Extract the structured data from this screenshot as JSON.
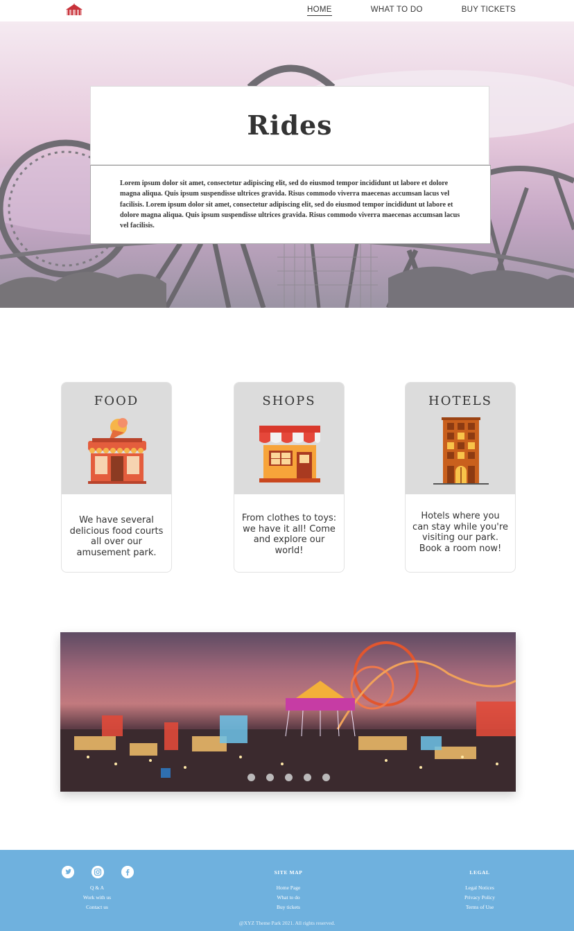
{
  "nav": {
    "links": [
      {
        "label": "HOME",
        "active": true
      },
      {
        "label": "WHAT TO DO",
        "active": false
      },
      {
        "label": "BUY TICKETS",
        "active": false
      }
    ]
  },
  "hero": {
    "title": "Rides",
    "text": "Lorem ipsum dolor sit amet, consectetur adipiscing elit, sed do eiusmod tempor incididunt ut labore et dolore magna aliqua. Quis ipsum suspendisse ultrices gravida. Risus commodo viverra maecenas accumsan lacus vel facilisis. Lorem ipsum dolor sit amet, consectetur adipiscing elit, sed do eiusmod tempor incididunt ut labore et dolore magna aliqua. Quis ipsum suspendisse ultrices gravida. Risus commodo viverra maecenas accumsan lacus vel facilisis."
  },
  "cards": [
    {
      "title": "FOOD",
      "icon": "food-stall-icon",
      "description": "We have several delicious food courts all over our amusement park."
    },
    {
      "title": "SHOPS",
      "icon": "shop-icon",
      "description": "From clothes to toys: we have it all! Come and explore our world!"
    },
    {
      "title": "HOTELS",
      "icon": "hotel-icon",
      "description": "Hotels where you can stay while you're visiting our park. Book a room now!"
    }
  ],
  "carousel": {
    "slide_count": 5,
    "active_slide": 1
  },
  "footer": {
    "social": [
      "twitter-icon",
      "instagram-icon",
      "facebook-icon"
    ],
    "about_links": [
      "Q & A",
      "Work with us",
      "Contact us"
    ],
    "sitemap_title": "SITE MAP",
    "sitemap_links": [
      "Home Page",
      "What to do",
      "Buy tickets"
    ],
    "legal_title": "LEGAL",
    "legal_links": [
      "Legal Notices",
      "Privacy Policy",
      "Terms of Use"
    ],
    "copyright": "@XYZ Theme Park 2021. All rights reserved."
  },
  "colors": {
    "footer_bg": "#6fb1de",
    "card_header_bg": "#dcdcdc",
    "logo_red": "#c8323a"
  }
}
